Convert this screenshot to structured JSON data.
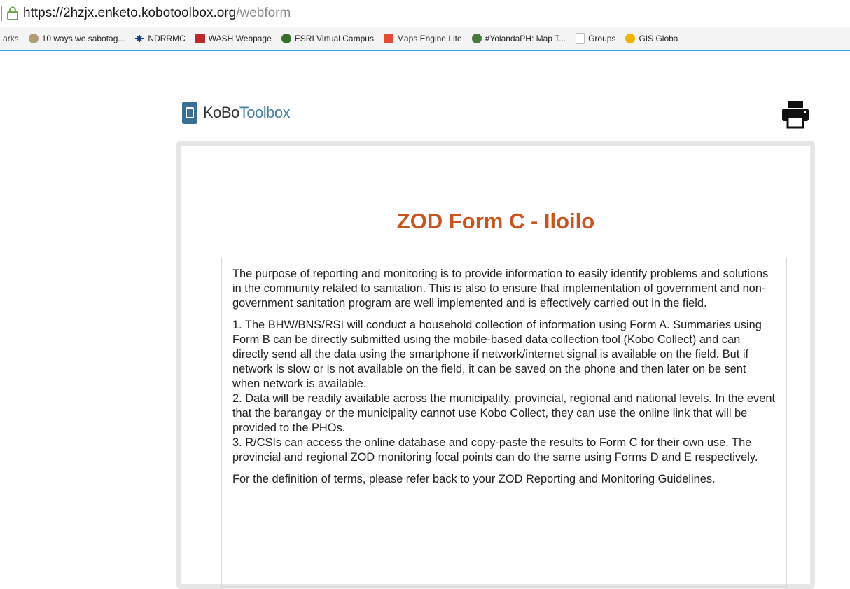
{
  "browser": {
    "url_host": "https://2hzjx.enketo.kobotoolbox.org",
    "url_path": "/webform",
    "bookmarks": [
      {
        "label": "arks",
        "icon": "none",
        "color": ""
      },
      {
        "label": "10 ways we sabotag...",
        "icon": "gear-icon",
        "color": "#b39b7a"
      },
      {
        "label": "NDRRMC",
        "icon": "plane-icon",
        "color": "#1b3f8f"
      },
      {
        "label": "WASH Webpage",
        "icon": "hr-icon",
        "color": "#c0292b"
      },
      {
        "label": "ESRI Virtual Campus",
        "icon": "globe-icon",
        "color": "#3b6d2e"
      },
      {
        "label": "Maps Engine Lite",
        "icon": "map-pin-icon",
        "color": "#e24a33"
      },
      {
        "label": "#YolandaPH: Map T...",
        "icon": "globe-icon",
        "color": "#4a7a3b"
      },
      {
        "label": "Groups",
        "icon": "document-icon",
        "color": "#f2d36b"
      },
      {
        "label": "GIS Globa",
        "icon": "sun-icon",
        "color": "#f0b400"
      }
    ]
  },
  "header": {
    "logo_kobo": "KoBo",
    "logo_toolbox": "Toolbox"
  },
  "form": {
    "title": "ZOD Form C - Iloilo",
    "intro_paragraph": "The purpose of reporting and monitoring is to provide information to easily identify problems and solutions in the community related to sanitation. This is also to ensure that implementation of government and non-government sanitation program are well implemented and is effectively carried out in the field.",
    "item_1": "1. The BHW/BNS/RSI will conduct a household collection of information using Form A. Summaries using Form B can be directly submitted using the mobile-based data collection tool (Kobo Collect) and can directly send all the data using the smartphone if network/internet signal is available on the field. But if network is slow or is not available on the field, it can be saved on the phone and then later on be sent when network is available.",
    "item_2": "2. Data will be readily available across the municipality, provincial, regional and national levels. In the event that the barangay or the municipality cannot use Kobo Collect, they can use the online link that will be provided to the PHOs.",
    "item_3": "3. R/CSIs can access the online database and copy-paste the results to Form C for their own use. The provincial and regional ZOD monitoring focal points can do the same using Forms D and E respectively.",
    "definition_note": "For the definition of terms, please refer back to your ZOD Reporting and Monitoring Guidelines."
  },
  "colors": {
    "title": "#c9541d",
    "bookmark_bar_accent": "#2d9fd9",
    "logo_blue": "#3a6f98"
  }
}
